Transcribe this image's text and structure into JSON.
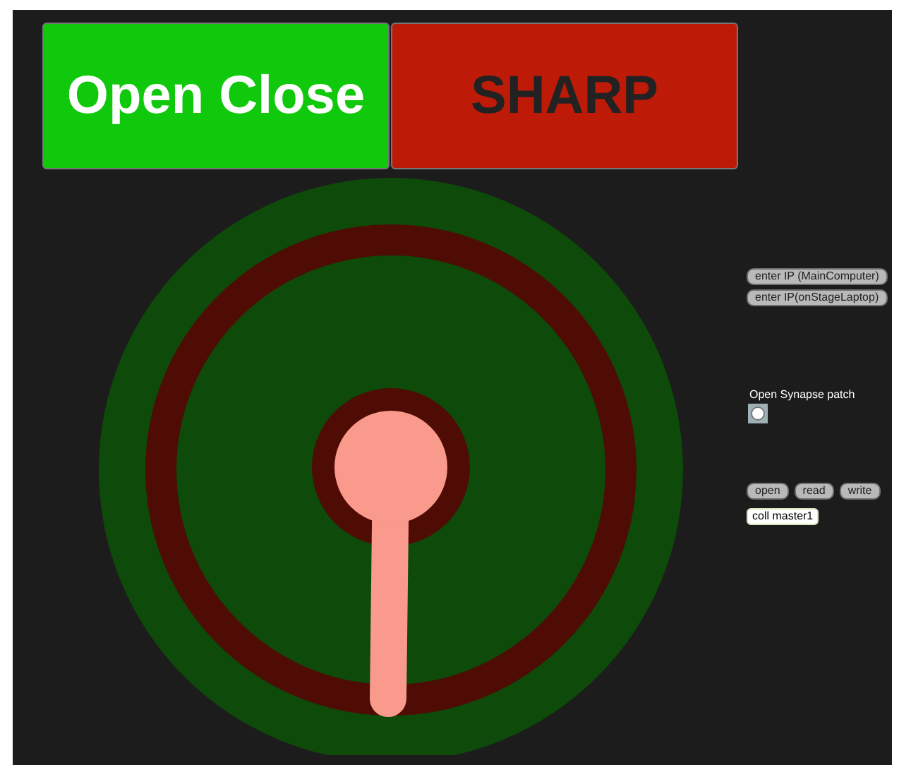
{
  "big_buttons": [
    {
      "label": "Open Close",
      "kind": "green"
    },
    {
      "label": "SHARP",
      "kind": "red"
    }
  ],
  "ip_buttons": [
    "enter IP (MainComputer)",
    "enter IP(onStageLaptop)"
  ],
  "synapse": {
    "label": "Open Synapse patch"
  },
  "coll_buttons": [
    "open",
    "read",
    "write"
  ],
  "coll_object": "coll master1"
}
